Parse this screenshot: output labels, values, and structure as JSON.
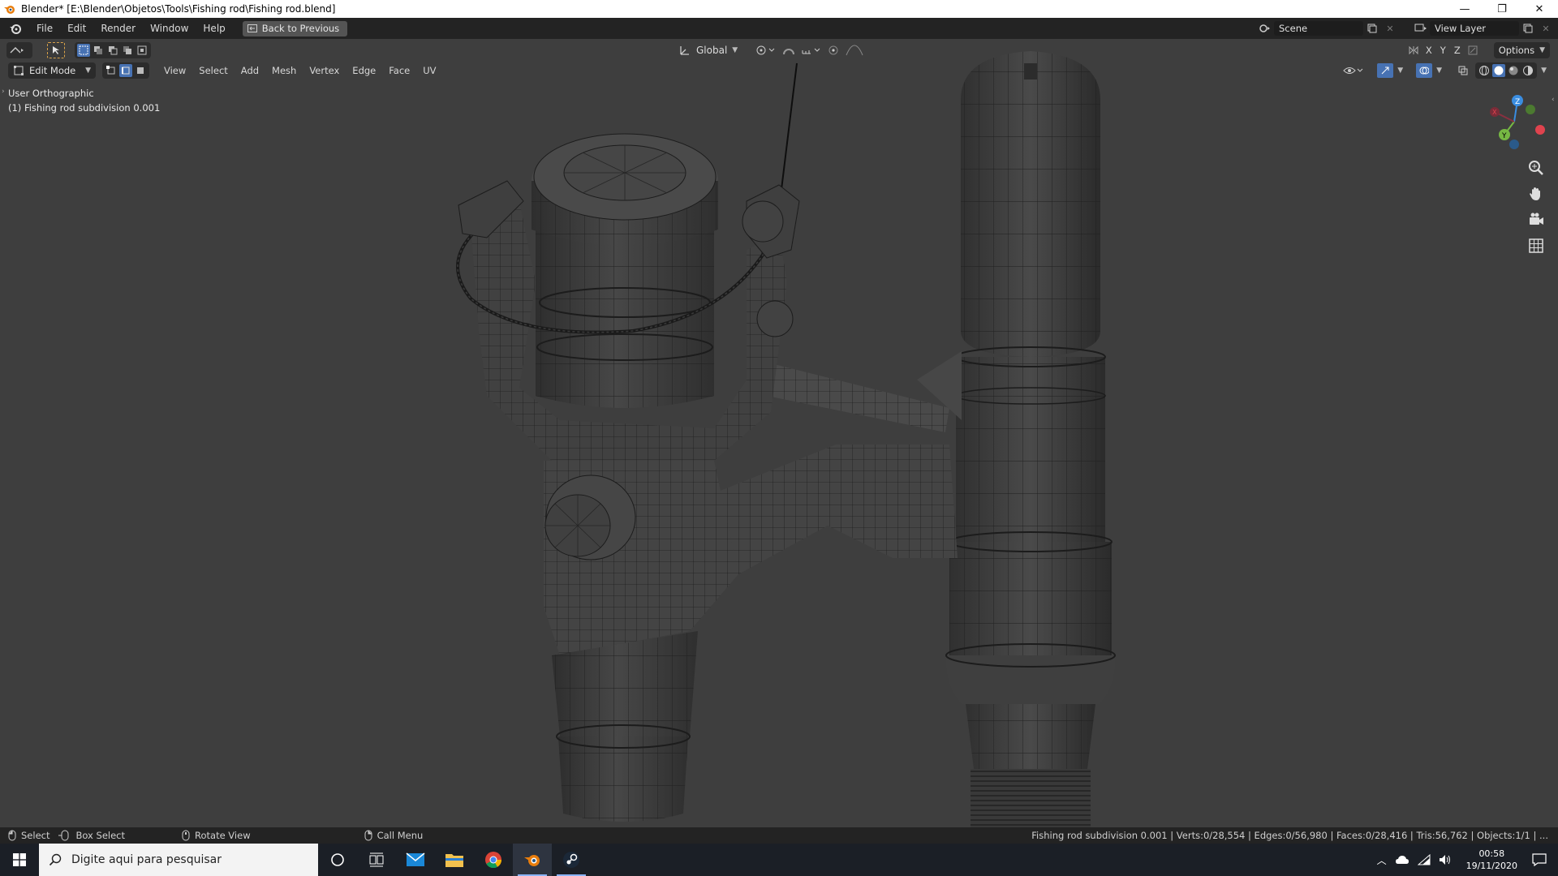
{
  "window": {
    "title": "Blender* [E:\\Blender\\Objetos\\Tools\\Fishing rod\\Fishing rod.blend]",
    "minimize": "—",
    "restore": "❐",
    "close": "✕"
  },
  "menubar": {
    "items": [
      "File",
      "Edit",
      "Render",
      "Window",
      "Help"
    ],
    "back_button": "Back to Previous",
    "scene_value": "Scene",
    "view_layer_value": "View Layer"
  },
  "viewport_header": {
    "transform_orientation": "Global",
    "axis_labels": [
      "X",
      "Y",
      "Z"
    ],
    "options_label": "Options",
    "mode": "Edit Mode",
    "menus": [
      "View",
      "Select",
      "Add",
      "Mesh",
      "Vertex",
      "Edge",
      "Face",
      "UV"
    ]
  },
  "overlay": {
    "view_name": "User Orthographic",
    "object_name": "(1) Fishing rod subdivision 0.001"
  },
  "statusbar": {
    "select": "Select",
    "box_select": "Box Select",
    "rotate_view": "Rotate View",
    "call_menu": "Call Menu",
    "stats": "Fishing rod subdivision 0.001 | Verts:0/28,554 | Edges:0/56,980 | Faces:0/28,416 | Tris:56,762 | Objects:1/1 | ..."
  },
  "taskbar": {
    "search_placeholder": "Digite aqui para pesquisar",
    "time": "00:58",
    "date": "19/11/2020"
  },
  "colors": {
    "accent": "#4772b3",
    "gizmo_x": "#e0434e",
    "gizmo_y": "#76b843",
    "gizmo_z": "#3a8de0"
  }
}
